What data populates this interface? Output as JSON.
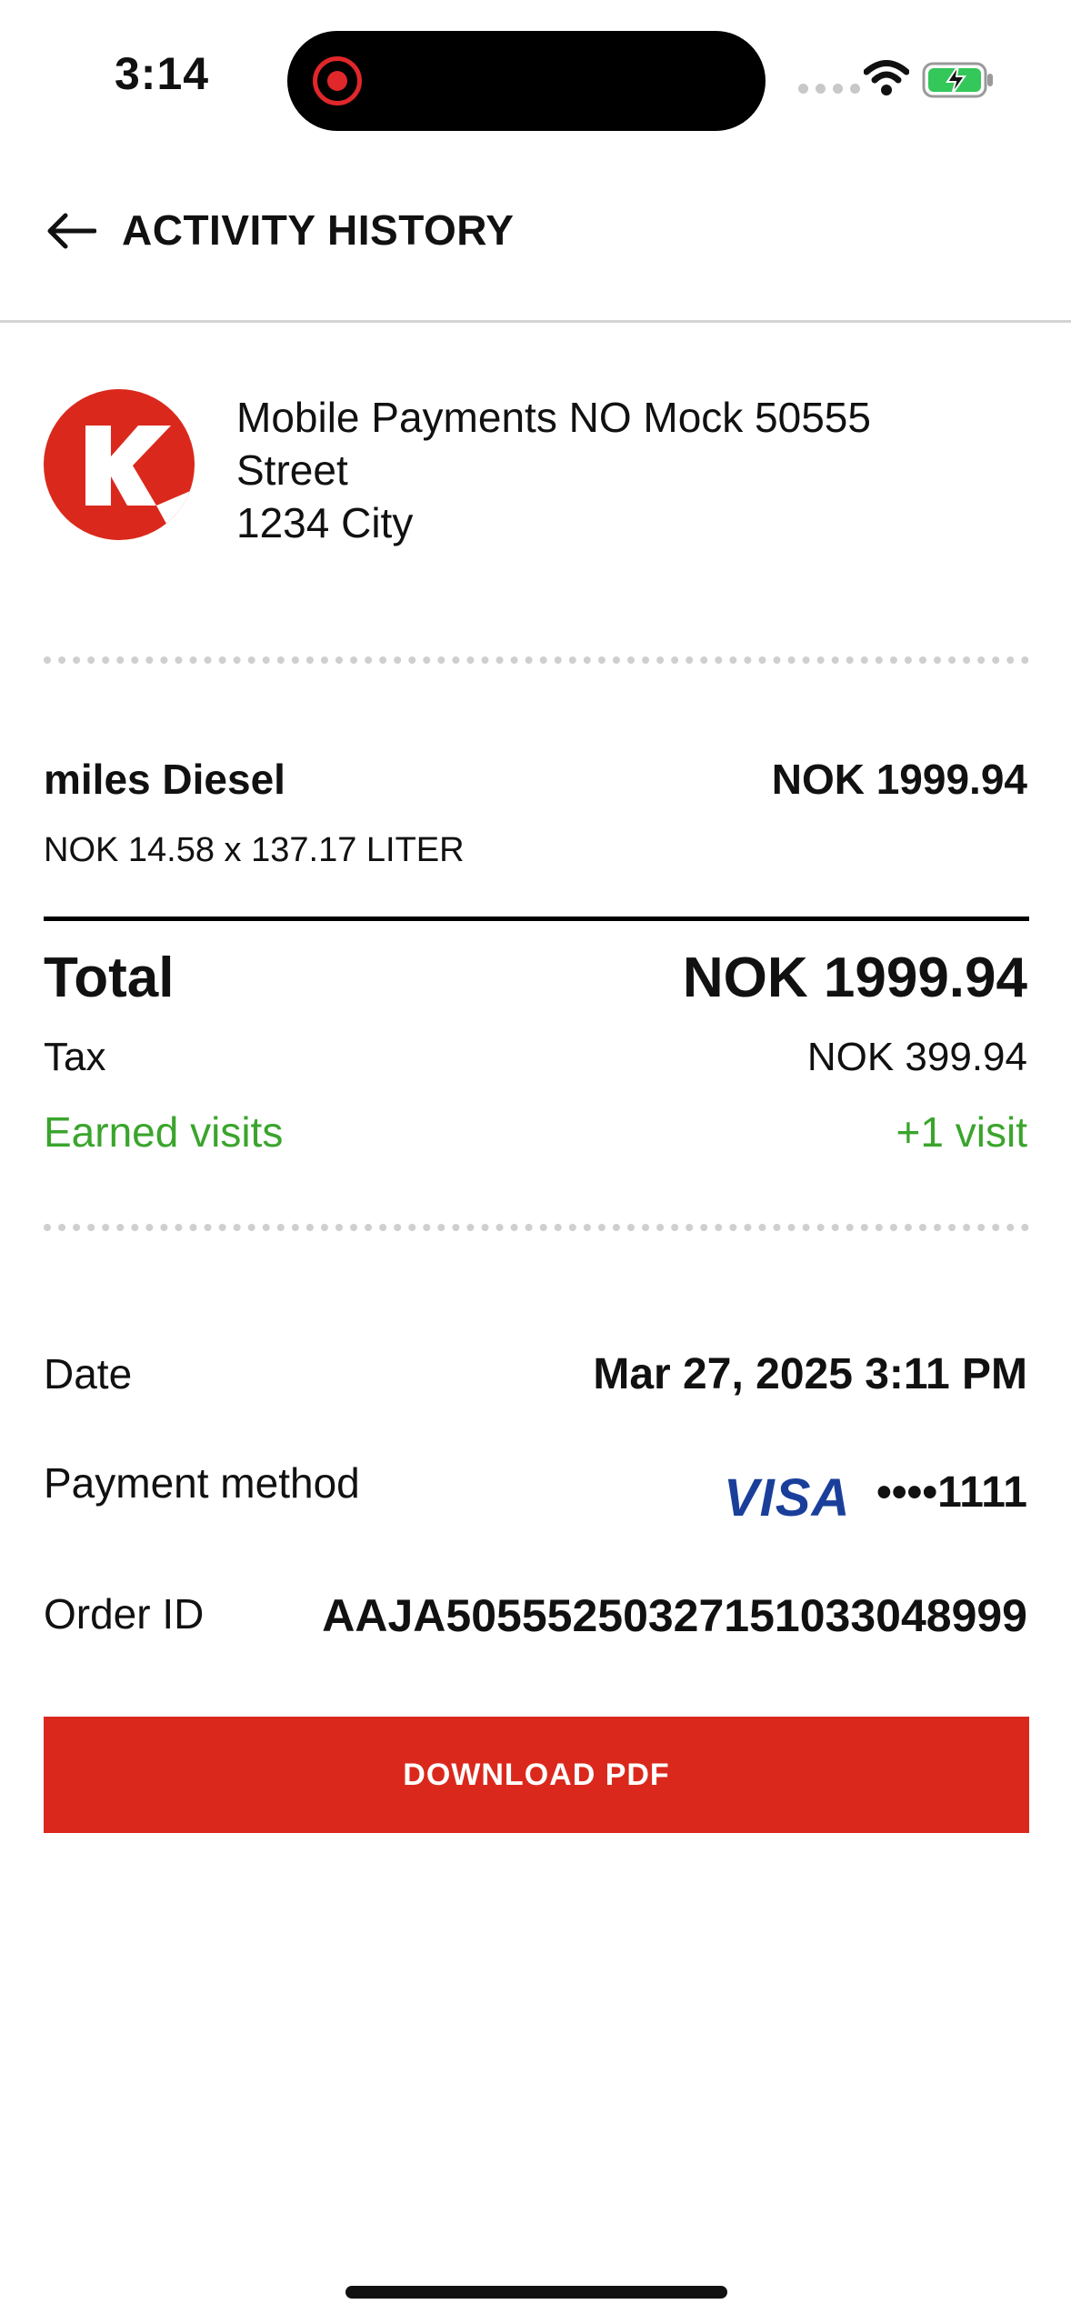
{
  "status_bar": {
    "time": "3:14",
    "recording_color": "#e0272a",
    "battery_color": "#34c759"
  },
  "header": {
    "title": "ACTIVITY HISTORY",
    "back_icon": "arrow-left-icon"
  },
  "merchant": {
    "logo_letter": "K",
    "logo_color": "#da291c",
    "address_line1": "Mobile Payments NO Mock 50555",
    "address_line2": "Street",
    "address_line3": "1234 City"
  },
  "line_item": {
    "name": "miles Diesel",
    "price": "NOK 1999.94",
    "detail": "NOK 14.58 x 137.17 LITER"
  },
  "summary": {
    "total_label": "Total",
    "total_value": "NOK 1999.94",
    "tax_label": "Tax",
    "tax_value": "NOK 399.94",
    "visits_label": "Earned visits",
    "visits_value": "+1 visit",
    "visits_color": "#3aa52c"
  },
  "details": {
    "date_label": "Date",
    "date_value": "Mar 27, 2025 3:11 PM",
    "payment_label": "Payment method",
    "card_brand": "VISA",
    "card_last": "••••1111",
    "order_label": "Order ID",
    "order_value": "AAJA5055525032715103304899​9"
  },
  "actions": {
    "download_label": "DOWNLOAD PDF",
    "download_color": "#da291c"
  }
}
